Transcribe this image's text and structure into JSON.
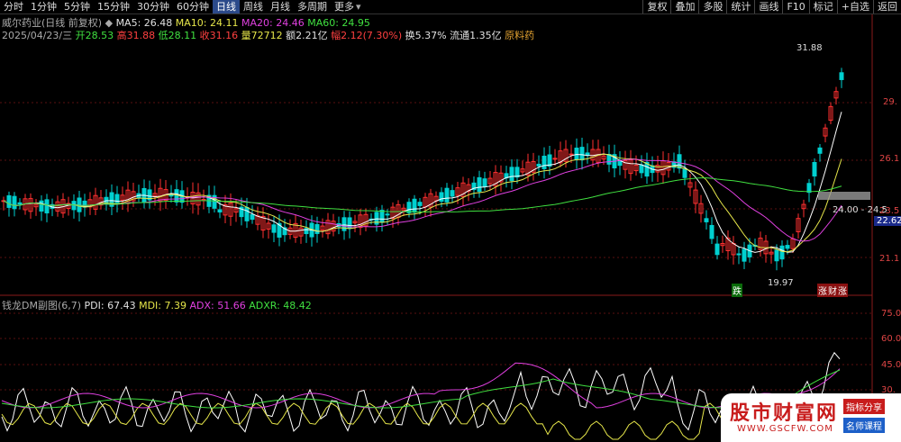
{
  "toolbar": {
    "timeframes": [
      "分时",
      "1分钟",
      "5分钟",
      "15分钟",
      "30分钟",
      "60分钟",
      "日线",
      "周线",
      "月线",
      "多周期",
      "更多"
    ],
    "active": "日线",
    "right_buttons": [
      "复权",
      "叠加",
      "多股",
      "统计",
      "画线",
      "F10",
      "标记",
      "+自选",
      "返回"
    ]
  },
  "quote": {
    "name": "威尔药业(日线 前复权)",
    "ma5": "MA5: 26.48",
    "ma10": "MA10: 24.11",
    "ma20": "MA20: 24.46",
    "ma60": "MA60: 24.95",
    "date": "2025/04/23/三",
    "open": "开28.53",
    "high": "高31.88",
    "low": "低28.11",
    "close": "收31.16",
    "volume": "量72712",
    "amount": "额2.21亿",
    "change": "幅2.12(7.30%)",
    "turnover": "换5.37%",
    "float": "流通1.35亿",
    "sector": "原料药"
  },
  "indicator": {
    "name": "钱龙DM副图(6,7)",
    "pdi": "PDI: 67.43",
    "mdi": "MDI: 7.39",
    "adx": "ADX: 51.66",
    "adxr": "ADXR: 48.42"
  },
  "axis": {
    "main": [
      "29.",
      "26.1",
      "23.5",
      "21.1"
    ],
    "sub": [
      "75.0",
      "60.0",
      "45.0",
      "30."
    ],
    "current_price": "22.62"
  },
  "annotations": {
    "high_label": "31.88",
    "low_label": "19.97",
    "range_label": "24.00 - 24.5",
    "fall_tag": "跌",
    "rise_tag": "涨",
    "report_tag": "财"
  },
  "colors": {
    "up": "#ff3030",
    "down": "#00d0d0",
    "ma5": "#ffffff",
    "ma10": "#e6e64a",
    "ma20": "#e040e0",
    "ma60": "#40e040"
  },
  "watermark": {
    "title": "股市财富网",
    "url": "WWW.GSCFW.COM",
    "tag1": "指标分享",
    "tag2": "名师课程"
  }
}
